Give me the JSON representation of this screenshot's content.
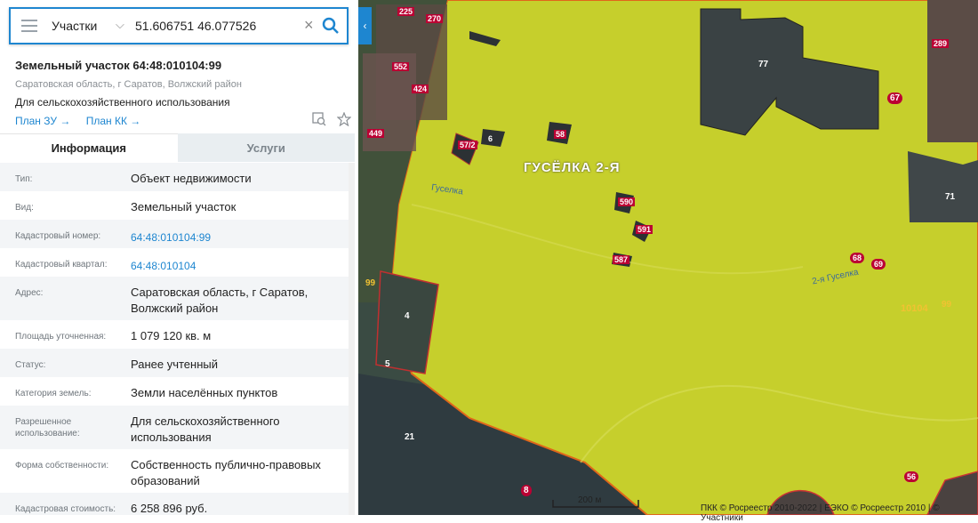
{
  "search": {
    "mode": "Участки",
    "query": "51.606751 46.077526"
  },
  "object": {
    "title": "Земельный участок 64:48:010104:99",
    "address": "Саратовская область, г Саратов, Волжский район",
    "usage": "Для сельскохозяйственного использования",
    "links": [
      "План ЗУ",
      "План КК"
    ]
  },
  "tabs": [
    "Информация",
    "Услуги"
  ],
  "info": {
    "type_k": "Тип:",
    "type_v": "Объект недвижимости",
    "kind_k": "Вид:",
    "kind_v": "Земельный участок",
    "cad_k": "Кадастровый номер:",
    "cad_v": "64:48:010104:99",
    "quarter_k": "Кадастровый квартал:",
    "quarter_v": "64:48:010104",
    "addr_k": "Адрес:",
    "addr_v": "Саратовская область, г Саратов, Волжский район",
    "area_k": "Площадь уточненная:",
    "area_v": "1 079 120 кв. м",
    "status_k": "Статус:",
    "status_v": "Ранее учтенный",
    "cat_k": "Категория земель:",
    "cat_v": "Земли населённых пунктов",
    "perm_k": "Разрешенное использование:",
    "perm_v": "Для сельскохозяйственного использования",
    "own_k": "Форма собственности:",
    "own_v": "Собственность публично-правовых образований",
    "cost_k": "Кадастровая стоимость:",
    "cost_v": "6 258 896 руб."
  },
  "map": {
    "village": "ГУСЁЛКА 2-Я",
    "river1": "Гуселка",
    "river2": "2-я Гуселка",
    "parcel_id": "10104",
    "scale": "200 м",
    "copyright": "ПКК © Росреестр 2010-2022 | ЕЭКО © Росреестр 2010 | © Участники",
    "tags": [
      "77",
      "67",
      "71",
      "68",
      "69",
      "4",
      "5",
      "21",
      "56",
      "99",
      "99",
      "590",
      "591",
      "587",
      "6",
      "58",
      "57/2",
      "8",
      "270",
      "289",
      "552",
      "225",
      "449",
      "424"
    ]
  }
}
